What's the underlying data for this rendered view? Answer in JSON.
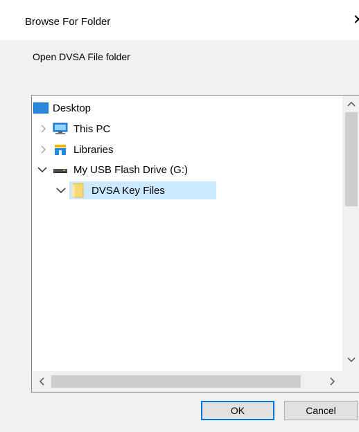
{
  "dialog": {
    "title": "Browse For Folder",
    "close_glyph": "✕",
    "instruction": "Open DVSA File folder"
  },
  "tree": {
    "items": [
      {
        "label": "Desktop",
        "icon": "desktop-icon",
        "expander": "none"
      },
      {
        "label": "This PC",
        "icon": "computer-icon",
        "expander": "collapsed"
      },
      {
        "label": "Libraries",
        "icon": "libraries-icon",
        "expander": "collapsed"
      },
      {
        "label": "My USB Flash Drive (G:)",
        "icon": "usb-drive-icon",
        "expander": "expanded"
      },
      {
        "label": "DVSA Key Files",
        "icon": "folder-icon",
        "expander": "expanded",
        "selected": true
      }
    ]
  },
  "buttons": {
    "ok": "OK",
    "cancel": "Cancel"
  },
  "colors": {
    "selection": "#cce8ff",
    "accent": "#0078d7",
    "folder": "#f8d775"
  }
}
